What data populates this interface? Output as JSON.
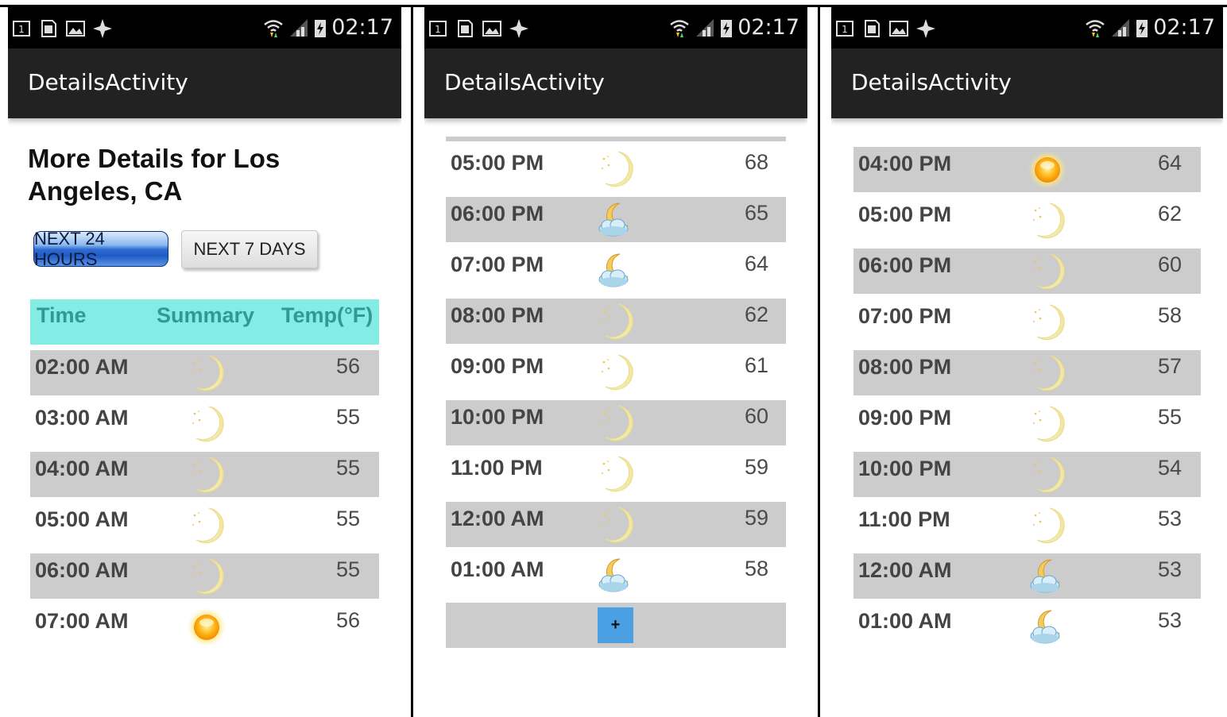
{
  "status_time": "02:17",
  "app_title": "DetailsActivity",
  "heading": "More Details for Los Angeles, CA",
  "buttons": {
    "next24": "NEXT 24 HOURS",
    "next7": "NEXT 7 DAYS"
  },
  "table_header": {
    "time": "Time",
    "summary": "Summary",
    "temp": "Temp(°F)"
  },
  "plus_label": "+",
  "screen1_rows": [
    {
      "time": "02:00 AM",
      "icon": "moon-icon",
      "temp": "56"
    },
    {
      "time": "03:00 AM",
      "icon": "moon-icon",
      "temp": "55"
    },
    {
      "time": "04:00 AM",
      "icon": "moon-icon",
      "temp": "55"
    },
    {
      "time": "05:00 AM",
      "icon": "moon-icon",
      "temp": "55"
    },
    {
      "time": "06:00 AM",
      "icon": "moon-icon",
      "temp": "55"
    },
    {
      "time": "07:00 AM",
      "icon": "sun-icon",
      "temp": "56"
    }
  ],
  "screen2_rows": [
    {
      "time": "05:00 PM",
      "icon": "moon-icon",
      "temp": "68"
    },
    {
      "time": "06:00 PM",
      "icon": "moon-cloud-icon",
      "temp": "65"
    },
    {
      "time": "07:00 PM",
      "icon": "moon-cloud-icon",
      "temp": "64"
    },
    {
      "time": "08:00 PM",
      "icon": "moon-icon",
      "temp": "62"
    },
    {
      "time": "09:00 PM",
      "icon": "moon-icon",
      "temp": "61"
    },
    {
      "time": "10:00 PM",
      "icon": "moon-icon",
      "temp": "60"
    },
    {
      "time": "11:00 PM",
      "icon": "moon-icon",
      "temp": "59"
    },
    {
      "time": "12:00 AM",
      "icon": "moon-icon",
      "temp": "59"
    },
    {
      "time": "01:00 AM",
      "icon": "moon-cloud-icon",
      "temp": "58"
    }
  ],
  "screen3_rows": [
    {
      "time": "04:00 PM",
      "icon": "sun-icon",
      "temp": "64"
    },
    {
      "time": "05:00 PM",
      "icon": "moon-icon",
      "temp": "62"
    },
    {
      "time": "06:00 PM",
      "icon": "moon-icon",
      "temp": "60"
    },
    {
      "time": "07:00 PM",
      "icon": "moon-icon",
      "temp": "58"
    },
    {
      "time": "08:00 PM",
      "icon": "moon-icon",
      "temp": "57"
    },
    {
      "time": "09:00 PM",
      "icon": "moon-icon",
      "temp": "55"
    },
    {
      "time": "10:00 PM",
      "icon": "moon-icon",
      "temp": "54"
    },
    {
      "time": "11:00 PM",
      "icon": "moon-icon",
      "temp": "53"
    },
    {
      "time": "12:00 AM",
      "icon": "moon-cloud-icon",
      "temp": "53"
    },
    {
      "time": "01:00 AM",
      "icon": "moon-cloud-icon",
      "temp": "53"
    }
  ]
}
